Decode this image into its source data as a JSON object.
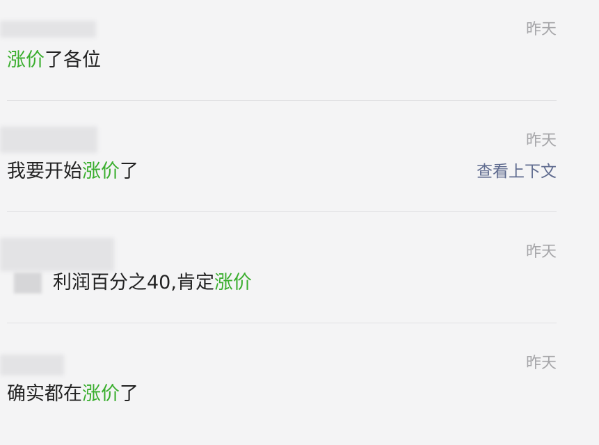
{
  "messages": [
    {
      "time": "昨天",
      "parts": [
        {
          "text": "涨价",
          "highlight": true
        },
        {
          "text": "了各位",
          "highlight": false
        }
      ]
    },
    {
      "time": "昨天",
      "parts": [
        {
          "text": "我要开始",
          "highlight": false
        },
        {
          "text": "涨价",
          "highlight": true
        },
        {
          "text": "了",
          "highlight": false
        }
      ],
      "context_link": "查看上下文"
    },
    {
      "time": "昨天",
      "parts": [
        {
          "text": "利润百分之40,肯定",
          "highlight": false
        },
        {
          "text": "涨价",
          "highlight": true
        }
      ]
    },
    {
      "time": "昨天",
      "parts": [
        {
          "text": "确实都在",
          "highlight": false
        },
        {
          "text": "涨价",
          "highlight": true
        },
        {
          "text": "了",
          "highlight": false
        }
      ]
    }
  ],
  "colors": {
    "keyword": "#3aae2e",
    "text": "#222222",
    "time": "#a5a5a8",
    "link": "#5f6b8f",
    "background": "#f4f4f5"
  }
}
